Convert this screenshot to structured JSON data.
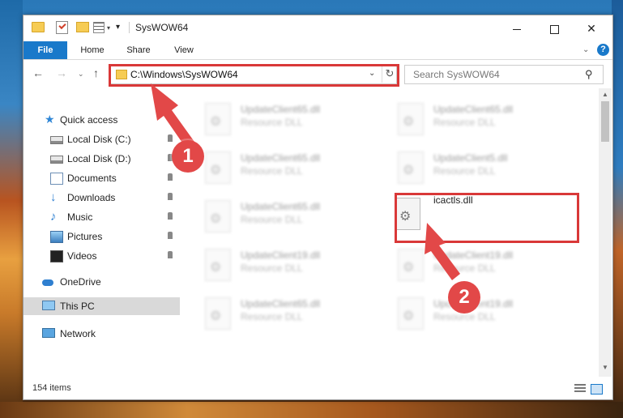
{
  "window": {
    "title": "SysWOW64",
    "close_glyph": "✕"
  },
  "ribbon": {
    "tabs": [
      "File",
      "Home",
      "Share",
      "View"
    ],
    "help_glyph": "?",
    "expand_glyph": "⌄"
  },
  "address": {
    "path": "C:\\Windows\\SysWOW64",
    "refresh_glyph": "↻",
    "chevron_glyph": "⌄"
  },
  "nav_buttons": {
    "back": "←",
    "forward": "→",
    "recent": "⌄",
    "up": "↑"
  },
  "search": {
    "placeholder": "Search SysWOW64",
    "icon_glyph": "⚲"
  },
  "sidebar": {
    "items": [
      {
        "label": "Quick access",
        "icon": "star-icon",
        "pinned": false
      },
      {
        "label": "Local Disk (C:)",
        "icon": "disk-icon",
        "pinned": true
      },
      {
        "label": "Local Disk (D:)",
        "icon": "disk-icon",
        "pinned": true
      },
      {
        "label": "Documents",
        "icon": "documents-icon",
        "pinned": true
      },
      {
        "label": "Downloads",
        "icon": "download-icon",
        "pinned": true
      },
      {
        "label": "Music",
        "icon": "music-icon",
        "pinned": true
      },
      {
        "label": "Pictures",
        "icon": "pictures-icon",
        "pinned": true
      },
      {
        "label": "Videos",
        "icon": "videos-icon",
        "pinned": true
      },
      {
        "label": "OneDrive",
        "icon": "cloud-icon",
        "pinned": false
      },
      {
        "label": "This PC",
        "icon": "pc-icon",
        "pinned": false,
        "selected": true
      },
      {
        "label": "Network",
        "icon": "network-icon",
        "pinned": false
      }
    ]
  },
  "files": [
    {
      "name": "UpdateClient65.dll",
      "type": "Resource DLL",
      "blurred": true
    },
    {
      "name": "UpdateClient65.dll",
      "type": "Resource DLL",
      "blurred": true
    },
    {
      "name": "UpdateClient65.dll",
      "type": "Resource DLL",
      "blurred": true
    },
    {
      "name": "UpdateClient5.dll",
      "type": "Resource DLL",
      "blurred": true
    },
    {
      "name": "UpdateClient65.dll",
      "type": "Resource DLL",
      "blurred": true
    },
    {
      "name": "icactls.dll",
      "type": "",
      "blurred": false
    },
    {
      "name": "UpdateClient19.dll",
      "type": "Resource DLL",
      "blurred": true
    },
    {
      "name": "UpdateClient19.dll",
      "type": "Resource DLL",
      "blurred": true
    },
    {
      "name": "UpdateClient65.dll",
      "type": "Resource DLL",
      "blurred": true
    },
    {
      "name": "UpdateClient19.dll",
      "type": "Resource DLL",
      "blurred": true
    }
  ],
  "status": {
    "item_count": "154 items"
  },
  "callouts": [
    {
      "number": "1",
      "color": "#e24848"
    },
    {
      "number": "2",
      "color": "#e24848"
    }
  ],
  "colors": {
    "accent": "#1979ca",
    "highlight": "#d93838"
  }
}
